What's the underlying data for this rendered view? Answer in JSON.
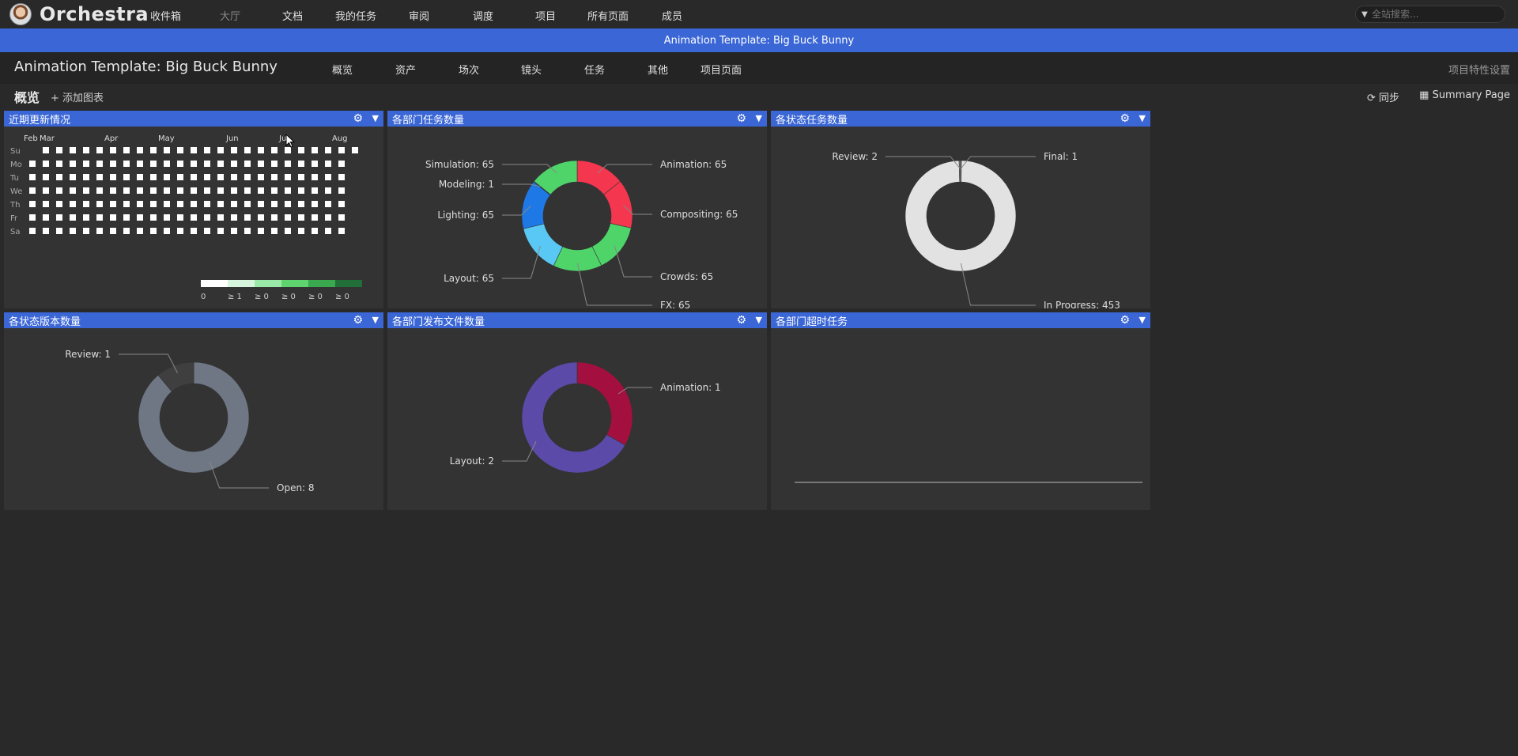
{
  "topbar": {
    "brand": "Orchestra",
    "nav": [
      "收件箱",
      "大厅",
      "文档",
      "我的任务",
      "审阅",
      "调度",
      "项目",
      "所有页面",
      "成员"
    ],
    "search_placeholder": "全站搜索..."
  },
  "banner": {
    "text": "Animation Template: Big Buck Bunny"
  },
  "project": {
    "title": "Animation Template: Big Buck Bunny",
    "tabs": [
      "概览",
      "资产",
      "场次",
      "镜头",
      "任务",
      "其他",
      "项目页面"
    ],
    "settings_label": "项目特性设置"
  },
  "subbar": {
    "title": "概览",
    "add_chart": "添加图表",
    "sync": "同步",
    "summary": "Summary Page"
  },
  "panels": {
    "recent": {
      "title": "近期更新情况"
    },
    "dept_tasks": {
      "title": "各部门任务数量"
    },
    "status_tasks": {
      "title": "各状态任务数量"
    },
    "status_versions": {
      "title": "各状态版本数量"
    },
    "dept_publish": {
      "title": "各部门发布文件数量"
    },
    "dept_overdue": {
      "title": "各部门超时任务"
    }
  },
  "chart_data": [
    {
      "type": "heatmap",
      "title": "近期更新情况",
      "months": [
        "Feb",
        "Mar",
        "Apr",
        "May",
        "Jun",
        "Jul",
        "Aug"
      ],
      "days": [
        "Su",
        "Mo",
        "Tu",
        "We",
        "Th",
        "Fr",
        "Sa"
      ],
      "legend": [
        "0",
        "≥ 1",
        "≥ 0",
        "≥ 0",
        "≥ 0",
        "≥ 0"
      ],
      "legend_colors": [
        "#ffffff",
        "#d6f5dc",
        "#9be9a8",
        "#5fd36e",
        "#3aa84f",
        "#216e39"
      ]
    },
    {
      "type": "pie",
      "title": "各部门任务数量",
      "labels": [
        "Animation",
        "Compositing",
        "Crowds",
        "FX",
        "Layout",
        "Lighting",
        "Modeling",
        "Simulation"
      ],
      "values": [
        65,
        65,
        65,
        65,
        65,
        65,
        1,
        65
      ],
      "label_text": [
        "Animation: 65",
        "Compositing: 65",
        "Crowds: 65",
        "FX: 65",
        "Layout: 65",
        "Lighting: 65",
        "Modeling: 1",
        "Simulation: 65"
      ],
      "colors": [
        "#f5364f",
        "#f5364f",
        "#4fd46a",
        "#4fd46a",
        "#5ac8f5",
        "#1e78e6",
        "#2a5fcf",
        "#4fd46a"
      ]
    },
    {
      "type": "pie",
      "title": "各状态任务数量",
      "labels": [
        "Final",
        "In Progress",
        "Review"
      ],
      "values": [
        1,
        453,
        2
      ],
      "label_text": [
        "Final: 1",
        "In Progress: 453",
        "Review: 2"
      ],
      "colors": [
        "#3a66d6",
        "#e2e2e2",
        "#8a8a8a"
      ]
    },
    {
      "type": "pie",
      "title": "各状态版本数量",
      "labels": [
        "Open",
        "Review"
      ],
      "values": [
        8,
        1
      ],
      "label_text": [
        "Open: 8",
        "Review: 1"
      ],
      "colors": [
        "#6f7784",
        "#3f3f3f"
      ]
    },
    {
      "type": "pie",
      "title": "各部门发布文件数量",
      "labels": [
        "Animation",
        "Layout"
      ],
      "values": [
        1,
        2
      ],
      "label_text": [
        "Animation: 1",
        "Layout: 2"
      ],
      "colors": [
        "#a3103f",
        "#5b4aa8"
      ]
    },
    {
      "type": "bar",
      "title": "各部门超时任务",
      "categories": [],
      "values": []
    }
  ]
}
